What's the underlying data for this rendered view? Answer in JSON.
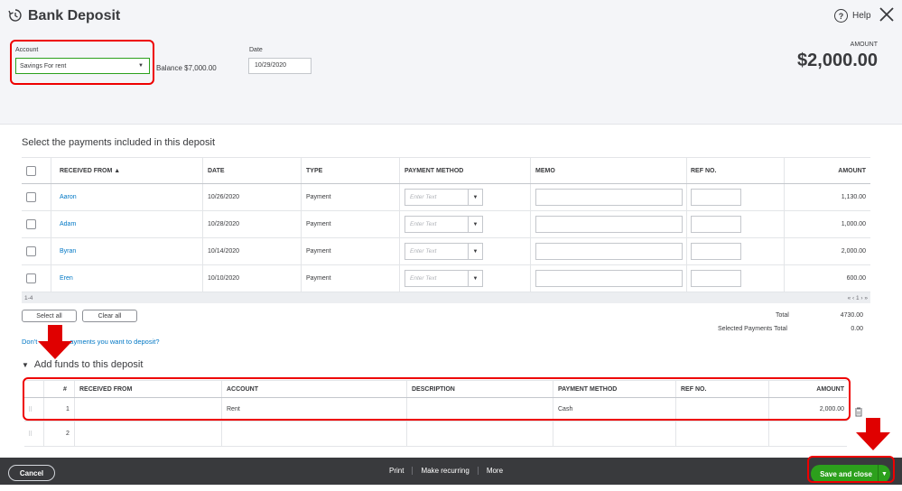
{
  "header": {
    "title": "Bank Deposit",
    "help_label": "Help",
    "account_label": "Account",
    "account_value": "Savings For rent",
    "balance_text": "Balance $7,000.00",
    "date_label": "Date",
    "date_value": "10/29/2020",
    "amount_label": "AMOUNT",
    "amount_value": "$2,000.00"
  },
  "payments": {
    "section_title": "Select the payments included in this deposit",
    "columns": [
      "RECEIVED FROM ▲",
      "DATE",
      "TYPE",
      "PAYMENT METHOD",
      "MEMO",
      "REF NO.",
      "AMOUNT"
    ],
    "placeholder": "Enter Text",
    "rows": [
      {
        "from": "Aaron",
        "date": "10/26/2020",
        "type": "Payment",
        "amount": "1,130.00"
      },
      {
        "from": "Adam",
        "date": "10/28/2020",
        "type": "Payment",
        "amount": "1,000.00"
      },
      {
        "from": "Byran",
        "date": "10/14/2020",
        "type": "Payment",
        "amount": "2,000.00"
      },
      {
        "from": "Eren",
        "date": "10/10/2020",
        "type": "Payment",
        "amount": "600.00"
      }
    ],
    "range": "1-4",
    "pager": "« ‹ 1 › »",
    "select_all": "Select all",
    "clear_all": "Clear all",
    "total_label": "Total",
    "total_value": "4730.00",
    "selected_label": "Selected Payments Total",
    "selected_value": "0.00",
    "dont_link_a": "Don't",
    "dont_link_b": "ayments you want to deposit?"
  },
  "funds": {
    "section_title": "Add funds to this deposit",
    "columns": [
      "#",
      "RECEIVED FROM",
      "ACCOUNT",
      "DESCRIPTION",
      "PAYMENT METHOD",
      "REF NO.",
      "AMOUNT"
    ],
    "rows": [
      {
        "num": "1",
        "from": "",
        "account": "Rent",
        "description": "",
        "method": "Cash",
        "ref": "",
        "amount": "2,000.00"
      },
      {
        "num": "2",
        "from": "",
        "account": "",
        "description": "",
        "method": "",
        "ref": "",
        "amount": ""
      }
    ]
  },
  "footer": {
    "cancel": "Cancel",
    "print": "Print",
    "make_recurring": "Make recurring",
    "more": "More",
    "save_close": "Save and close"
  },
  "colors": {
    "accent_green": "#2ca01c",
    "link_blue": "#0077c5",
    "annotation_red": "#e00000",
    "footer_dark": "#393a3d"
  }
}
